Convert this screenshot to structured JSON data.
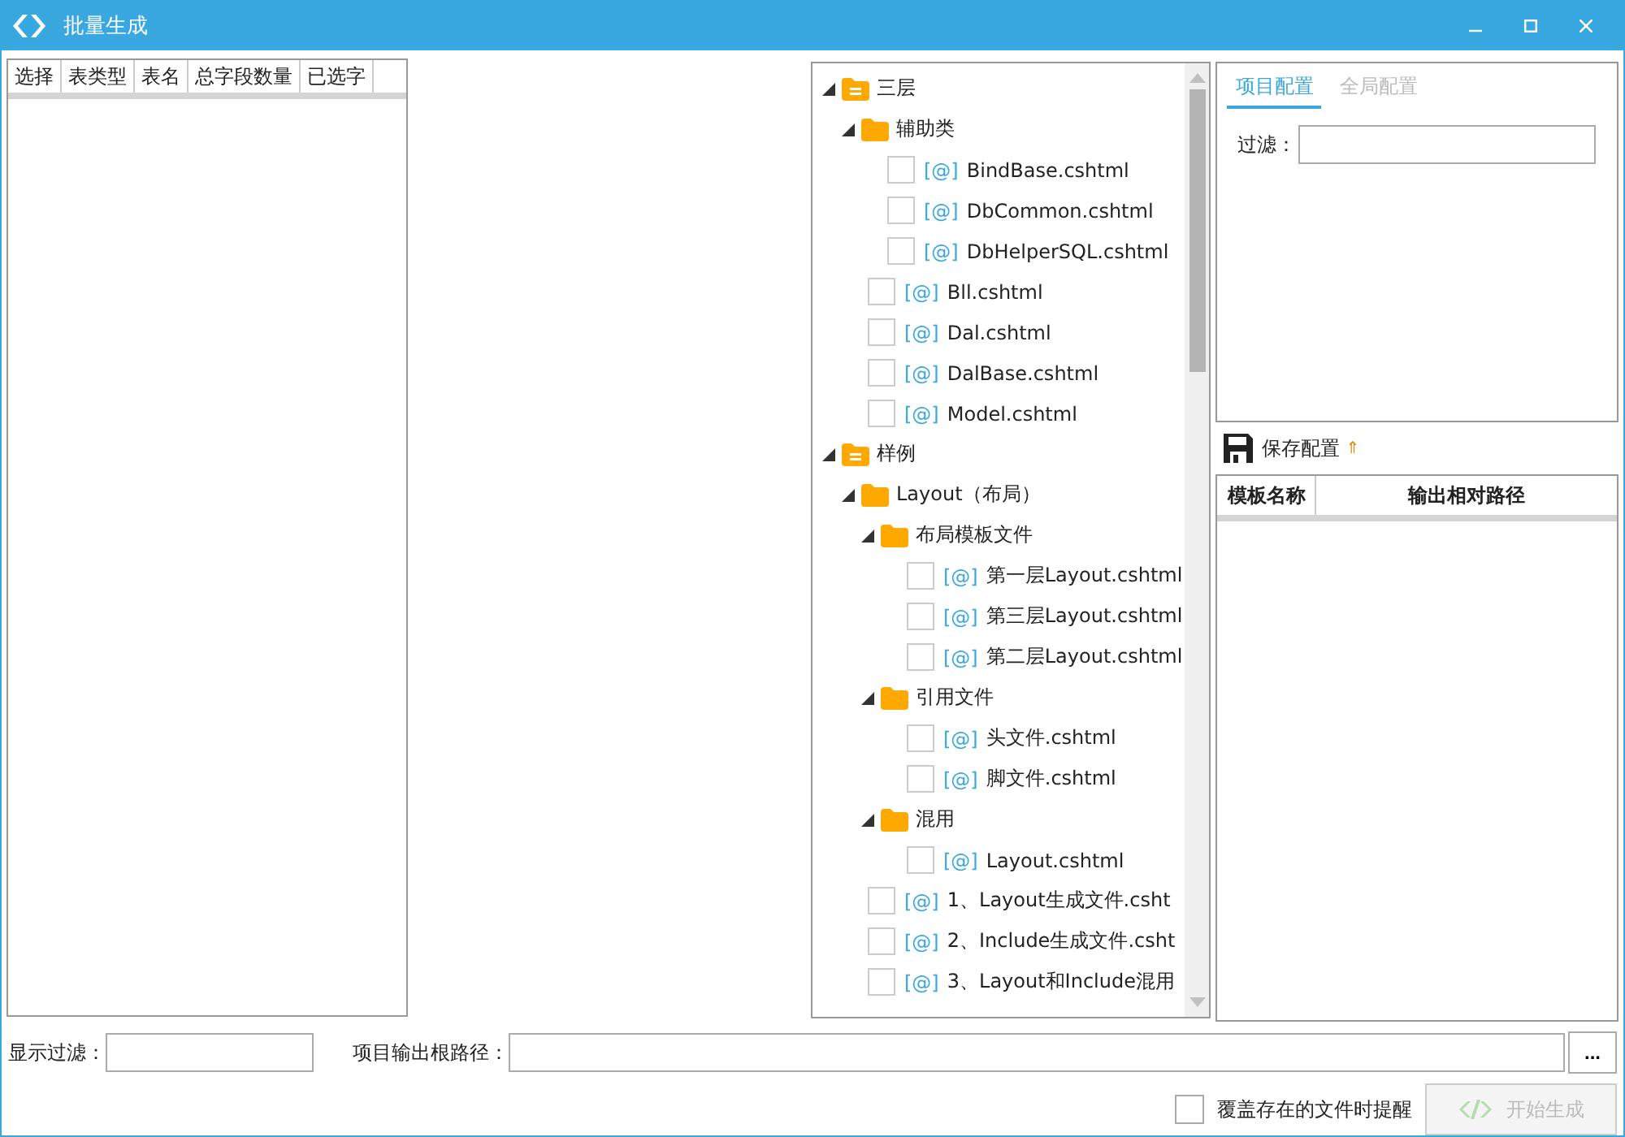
{
  "window": {
    "title": "批量生成"
  },
  "table_grid": {
    "columns": [
      "选择",
      "表类型",
      "表名",
      "总字段数量",
      "已选字"
    ]
  },
  "template_tree": [
    {
      "kind": "category",
      "label": "三层",
      "expanded": true,
      "children": [
        {
          "kind": "folder",
          "label": "辅助类",
          "expanded": true,
          "children": [
            {
              "kind": "file",
              "prefix": "[@]",
              "label": "BindBase.cshtml",
              "checked": false
            },
            {
              "kind": "file",
              "prefix": "[@]",
              "label": "DbCommon.cshtml",
              "checked": false
            },
            {
              "kind": "file",
              "prefix": "[@]",
              "label": "DbHelperSQL.cshtml",
              "checked": false
            }
          ]
        },
        {
          "kind": "file",
          "prefix": "[@]",
          "label": "Bll.cshtml",
          "checked": false
        },
        {
          "kind": "file",
          "prefix": "[@]",
          "label": "Dal.cshtml",
          "checked": false
        },
        {
          "kind": "file",
          "prefix": "[@]",
          "label": "DalBase.cshtml",
          "checked": false
        },
        {
          "kind": "file",
          "prefix": "[@]",
          "label": "Model.cshtml",
          "checked": false
        }
      ]
    },
    {
      "kind": "category",
      "label": "样例",
      "expanded": true,
      "children": [
        {
          "kind": "folder",
          "label": "Layout（布局）",
          "expanded": true,
          "children": [
            {
              "kind": "folder",
              "label": "布局模板文件",
              "expanded": true,
              "children": [
                {
                  "kind": "file",
                  "prefix": "[@]",
                  "label": "第一层Layout.cshtml",
                  "checked": false
                },
                {
                  "kind": "file",
                  "prefix": "[@]",
                  "label": "第三层Layout.cshtml",
                  "checked": false
                },
                {
                  "kind": "file",
                  "prefix": "[@]",
                  "label": "第二层Layout.cshtml",
                  "checked": false
                }
              ]
            },
            {
              "kind": "folder",
              "label": "引用文件",
              "expanded": true,
              "children": [
                {
                  "kind": "file",
                  "prefix": "[@]",
                  "label": "头文件.cshtml",
                  "checked": false
                },
                {
                  "kind": "file",
                  "prefix": "[@]",
                  "label": "脚文件.cshtml",
                  "checked": false
                }
              ]
            },
            {
              "kind": "folder",
              "label": "混用",
              "expanded": true,
              "children": [
                {
                  "kind": "file",
                  "prefix": "[@]",
                  "label": "Layout.cshtml",
                  "checked": false
                }
              ]
            }
          ]
        },
        {
          "kind": "file",
          "prefix": "[@]",
          "label": "1、Layout生成文件.csht",
          "checked": false
        },
        {
          "kind": "file",
          "prefix": "[@]",
          "label": "2、Include生成文件.csht",
          "checked": false
        },
        {
          "kind": "file",
          "prefix": "[@]",
          "label": "3、Layout和Include混用",
          "checked": false
        }
      ]
    }
  ],
  "config_tabs": [
    {
      "label": "项目配置",
      "selected": true
    },
    {
      "label": "全局配置",
      "selected": false
    }
  ],
  "filter": {
    "label": "过滤："
  },
  "save_config": {
    "label": "保存配置",
    "marker": "⇑"
  },
  "mapping_table": {
    "columns": [
      "模板名称",
      "输出相对路径"
    ]
  },
  "display_filter": {
    "label": "显示过滤："
  },
  "output_root": {
    "label": "项目输出根路径：",
    "browse": "..."
  },
  "overwrite_warning": {
    "label": "覆盖存在的文件时提醒",
    "checked": false
  },
  "start_button": {
    "label": "开始生成",
    "disabled": true
  }
}
